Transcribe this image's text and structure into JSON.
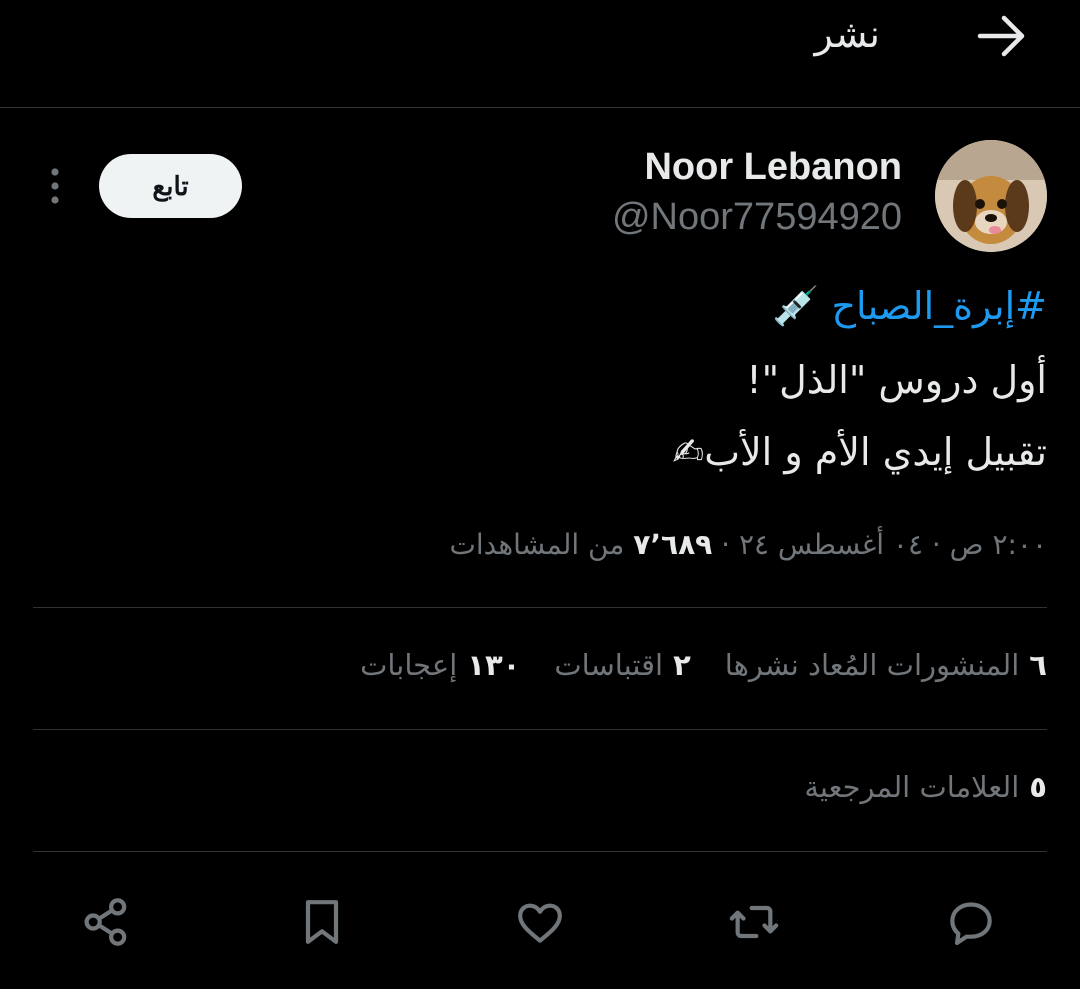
{
  "header": {
    "title": "نشر",
    "back_icon": "arrow-right-icon"
  },
  "author": {
    "name": "Noor Lebanon",
    "handle": "@Noor77594920",
    "follow_label": "تابع",
    "avatar_icon": "dog-avatar"
  },
  "tweet": {
    "hashtag": "#إبرة_الصباح",
    "hashtag_emoji": "💉",
    "line1": "أول دروس \"الذل\"!",
    "line2": "تقبيل إيدي الأم و الأب",
    "line2_emoji": "✍"
  },
  "meta": {
    "time_date": "٢:٠٠ ص · ٠٤ أغسطس ٢٤ · ",
    "views_count": "٧٬٦٨٩",
    "views_label": " من المشاهدات"
  },
  "stats": {
    "reposts_count": "٦",
    "reposts_label": "المنشورات المُعاد نشرها",
    "quotes_count": "٢",
    "quotes_label": "اقتباسات",
    "likes_count": "١٣٠",
    "likes_label": "إعجابات",
    "bookmarks_count": "٥",
    "bookmarks_label": "العلامات المرجعية"
  },
  "actions": [
    "reply-icon",
    "repost-icon",
    "like-icon",
    "bookmark-icon",
    "share-icon"
  ],
  "colors": {
    "background": "#000000",
    "text": "#e7e9ea",
    "muted": "#71767b",
    "accent": "#1d9bf0",
    "divider": "#2f3336"
  }
}
